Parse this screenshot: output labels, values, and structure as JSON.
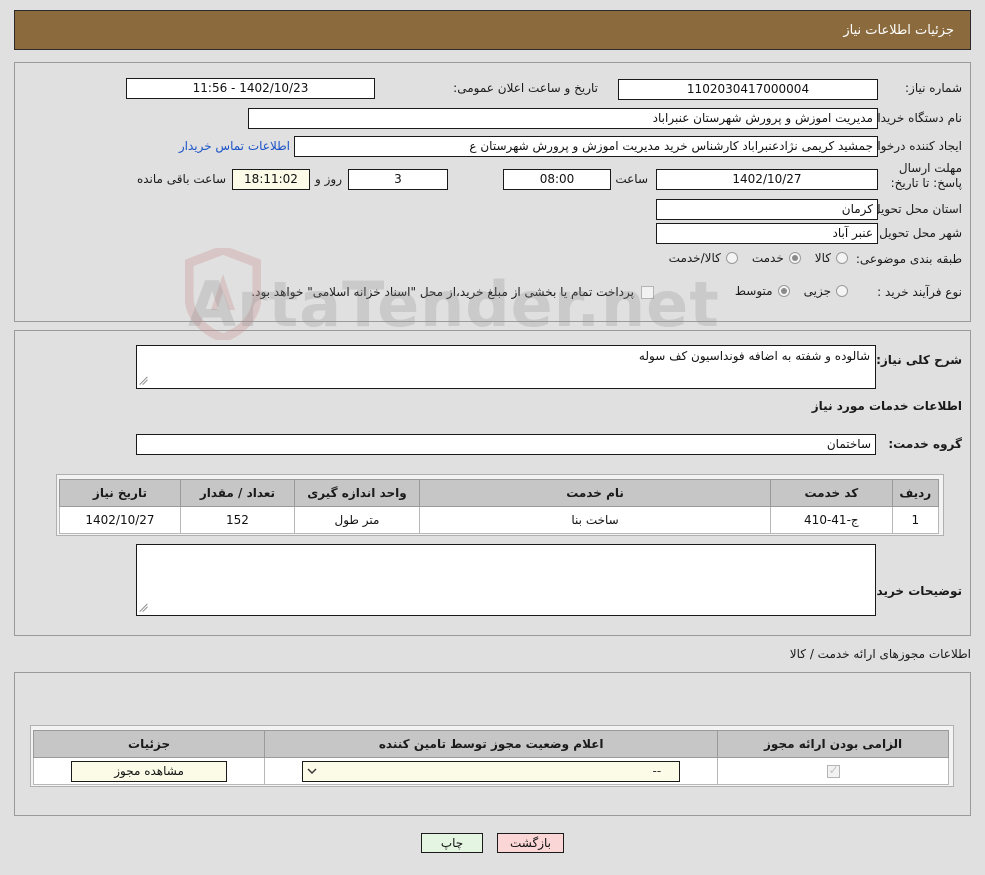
{
  "header": {
    "title": "جزئیات اطلاعات نیاز"
  },
  "top": {
    "need_number_label": "شماره نیاز:",
    "need_number_value": "1102030417000004",
    "announce_datetime_label": "تاریخ و ساعت اعلان عمومی:",
    "announce_datetime_value": "1402/10/23 - 11:56",
    "buyer_org_label": "نام دستگاه خریدار:",
    "buyer_org_value": "مدیریت اموزش و پرورش شهرستان عنبراباد",
    "requester_label": "ایجاد کننده درخواست:",
    "requester_value": "جمشید کریمی نژادعنبراباد کارشناس خرید مدیریت اموزش و پرورش شهرستان ع",
    "buyer_contact_link": "اطلاعات تماس خریدار",
    "deadline_label": "مهلت ارسال پاسخ: تا تاریخ:",
    "deadline_date": "1402/10/27",
    "time_label": "ساعت",
    "deadline_time": "08:00",
    "days_value": "3",
    "days_label": "روز و",
    "countdown_value": "18:11:02",
    "countdown_label": "ساعت باقی مانده",
    "province_label": "استان محل تحویل:",
    "province_value": "کرمان",
    "city_label": "شهر محل تحویل:",
    "city_value": "عنبر آباد",
    "category_label": "طبقه بندی موضوعی:",
    "category_options": [
      {
        "label": "کالا",
        "selected": false
      },
      {
        "label": "خدمت",
        "selected": true
      },
      {
        "label": "کالا/خدمت",
        "selected": false
      }
    ],
    "process_label": "نوع فرآیند خرید :",
    "process_options": [
      {
        "label": "جزیی",
        "selected": false
      },
      {
        "label": "متوسط",
        "selected": true
      }
    ],
    "treasury_checkbox_checked": false,
    "treasury_note": "پرداخت تمام یا بخشی از مبلغ خرید،از محل \"اسناد خزانه اسلامی\" خواهد بود."
  },
  "middle": {
    "general_desc_label": "شرح کلی نیاز:",
    "general_desc_value": "شالوده و شفته به اضافه فونداسیون کف سوله",
    "services_info_title": "اطلاعات خدمات مورد نیاز",
    "service_group_label": "گروه خدمت:",
    "service_group_value": "ساختمان",
    "buyer_notes_label": "توضیحات خریدار:",
    "buyer_notes_value": ""
  },
  "items_table": {
    "columns": [
      "ردیف",
      "کد خدمت",
      "نام خدمت",
      "واحد اندازه گیری",
      "تعداد / مقدار",
      "تاریخ نیاز"
    ],
    "rows": [
      {
        "row_no": "1",
        "service_code": "ج-41-410",
        "service_name": "ساخت بنا",
        "unit": "متر طول",
        "quantity": "152",
        "need_date": "1402/10/27"
      }
    ]
  },
  "permits": {
    "section_note": "اطلاعات مجوزهای ارائه خدمت / کالا",
    "columns": [
      "الزامی بودن ارائه مجوز",
      "اعلام وضعیت مجوز توسط تامین کننده",
      "جزئیات"
    ],
    "rows": [
      {
        "required_checked": true,
        "status_value": "--",
        "details_button": "مشاهده مجوز"
      }
    ]
  },
  "footer": {
    "print_label": "چاپ",
    "back_label": "بازگشت"
  },
  "watermark": {
    "text": "ArtaTender.net"
  },
  "colors": {
    "header_brown": "#8b6b3d",
    "link_blue": "#1a53c8",
    "print_green": "#e4f5e2",
    "back_pink": "#fbd6d6",
    "cream_field": "#fbfbe8",
    "table_header_gray": "#c6c6c6"
  }
}
